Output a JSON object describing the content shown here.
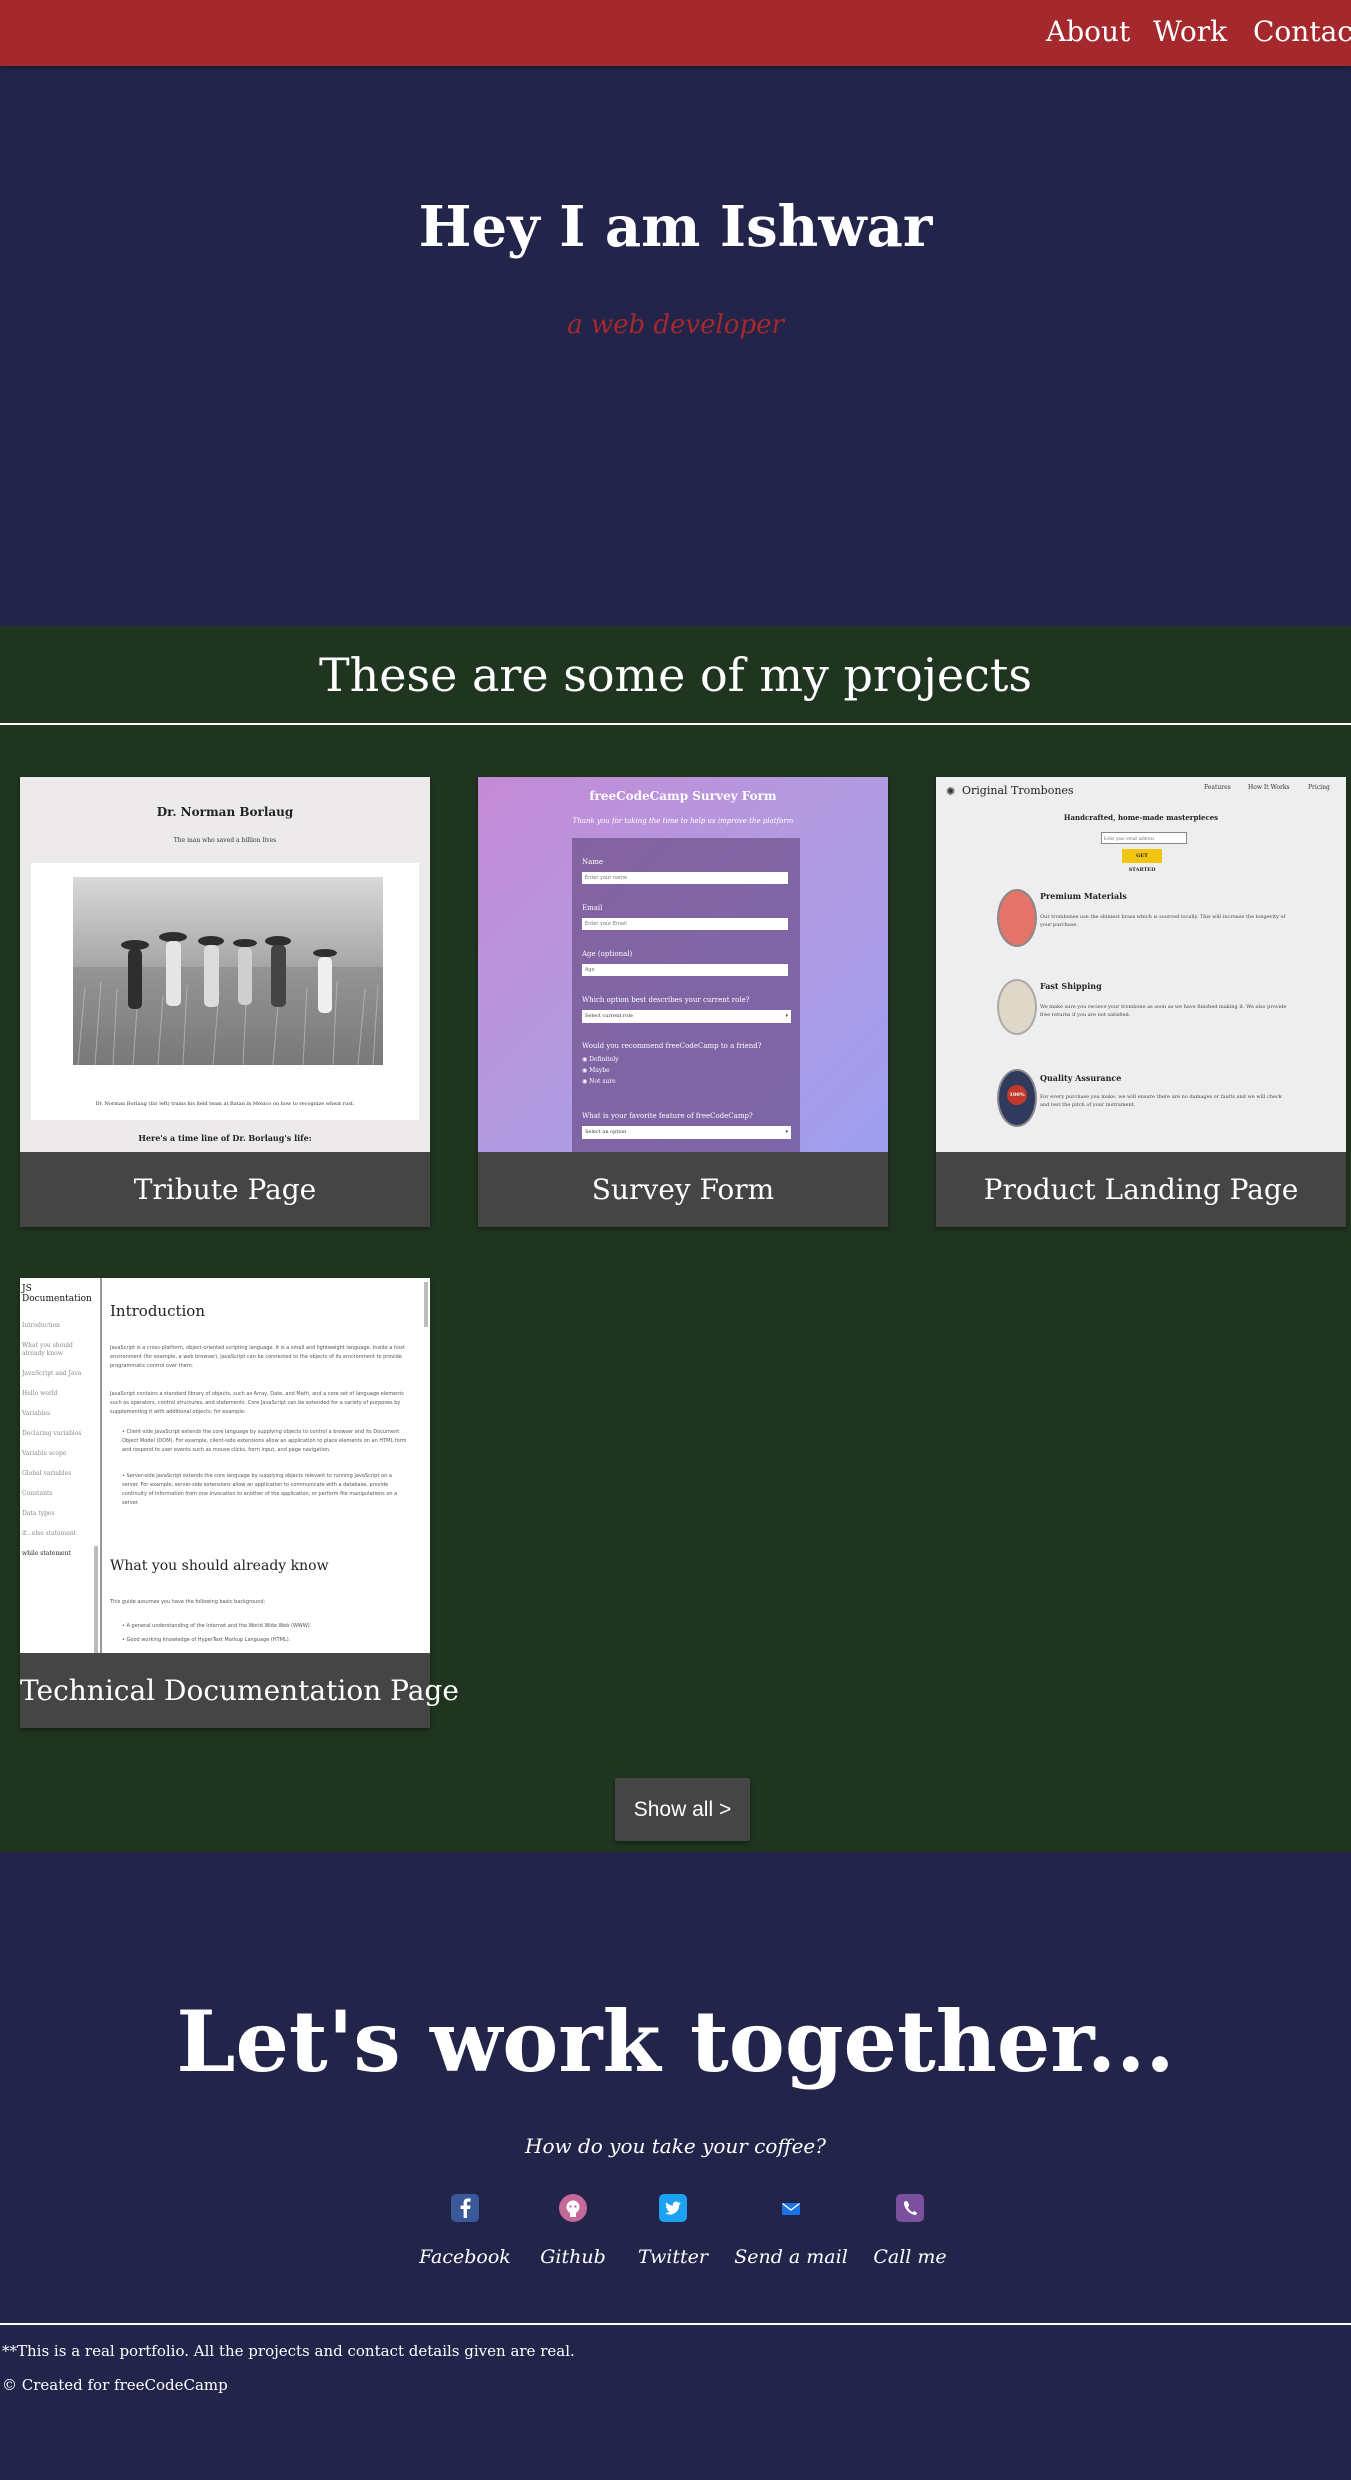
{
  "nav": {
    "about": "About",
    "work": "Work",
    "contact": "Contact"
  },
  "hero": {
    "title": "Hey I am Ishwar",
    "subtitle": "a web developer"
  },
  "projects": {
    "heading": "These are some of my projects",
    "items": [
      {
        "title": "Tribute Page"
      },
      {
        "title": "Survey Form"
      },
      {
        "title": "Product Landing Page"
      },
      {
        "title": "Technical Documentation Page"
      }
    ],
    "show_all": "Show all >"
  },
  "thumbs": {
    "tribute": {
      "heading": "Dr. Norman Borlaug",
      "tagline": "The man who saved a billion lives",
      "caption": "Dr. Norman Borlaug (far left) trains his field team at Batan in Mexico on how to recognize wheat rust.",
      "timeline": "Here's a time line of Dr. Borlaug's life:"
    },
    "survey": {
      "title": "freeCodeCamp Survey Form",
      "desc": "Thank you for taking the time to help us improve the platform",
      "name_label": "Name",
      "name_ph": "Enter your name",
      "email_label": "Email",
      "email_ph": "Enter your Email",
      "age_label": "Age (optional)",
      "age_ph": "Age",
      "role_q": "Which option best describes your current role?",
      "role_ph": "Select current role",
      "recommend_q": "Would you recommend freeCodeCamp to a friend?",
      "opt1": "Definitely",
      "opt2": "Maybe",
      "opt3": "Not sure",
      "feature_q": "What is your favorite feature of freeCodeCamp?",
      "feature_ph": "Select an option"
    },
    "landing": {
      "brand": "Original Trombones",
      "nav1": "Features",
      "nav2": "How It Works",
      "nav3": "Pricing",
      "headline": "Handcrafted, home-made masterpieces",
      "email_ph": "Enter your email address",
      "cta": "GET STARTED",
      "f1_title": "Premium Materials",
      "f1_text": "Our trombones use the shiniest brass which is sourced locally. This will increase the longevity of your purchase.",
      "f2_title": "Fast Shipping",
      "f2_text": "We make sure you recieve your trombone as soon as we have finished making it. We also provide free returns if you are not satisfied.",
      "f3_title": "Quality Assurance",
      "f3_text": "For every purchase you make, we will ensure there are no damages or faults and we will check and test the pitch of your instrument.",
      "badge": "100%"
    },
    "docs": {
      "side_title": "JS Documentation",
      "side_items": [
        "Introduction",
        "What you should already know",
        "JavaScript and Java",
        "Hello world",
        "Variables",
        "Declaring variables",
        "Variable scope",
        "Global variables",
        "Constants",
        "Data types",
        "if...else statement",
        "while statement"
      ],
      "h1": "Introduction",
      "p1": "JavaScript is a cross-platform, object-oriented scripting language. It is a small and lightweight language. Inside a host environment (for example, a web browser), JavaScript can be connected to the objects of its environment to provide programmatic control over them.",
      "p2": "JavaScript contains a standard library of objects, such as Array, Date, and Math, and a core set of language elements such as operators, control structures, and statements. Core JavaScript can be extended for a variety of purposes by supplementing it with additional objects; for example:",
      "li1": "Client-side JavaScript extends the core language by supplying objects to control a browser and its Document Object Model (DOM). For example, client-side extensions allow an application to place elements on an HTML form and respond to user events such as mouse clicks, form input, and page navigation.",
      "li2": "Server-side JavaScript extends the core language by supplying objects relevant to running JavaScript on a server. For example, server-side extensions allow an application to communicate with a database, provide continuity of information from one invocation to another of the application, or perform file manipulations on a server.",
      "h2": "What you should already know",
      "p3": "This guide assumes you have the following basic background:",
      "li3": "A general understanding of the Internet and the World Wide Web (WWW).",
      "li4": "Good working knowledge of HyperText Markup Language (HTML)."
    }
  },
  "contact": {
    "heading": "Let's work together...",
    "question": "How do you take your coffee?",
    "links": [
      {
        "label": "Facebook",
        "icon": "facebook-icon",
        "color": "#3b5998"
      },
      {
        "label": "Github",
        "icon": "github-icon",
        "color": "#c5699b"
      },
      {
        "label": "Twitter",
        "icon": "twitter-icon",
        "color": "#1da1f2"
      },
      {
        "label": "Send a mail",
        "icon": "mail-icon",
        "color": "#1a73e8"
      },
      {
        "label": "Call me",
        "icon": "viber-icon",
        "color": "#7b519d"
      }
    ]
  },
  "footer": {
    "note": "**This is a real portfolio. All the projects and contact details given are real.",
    "credit": "© Created for freeCodeCamp"
  },
  "colors": {
    "nav": "#a4282c",
    "hero_bg": "#22244a",
    "projects_bg": "#1f3520",
    "caption_bg": "#454545"
  }
}
